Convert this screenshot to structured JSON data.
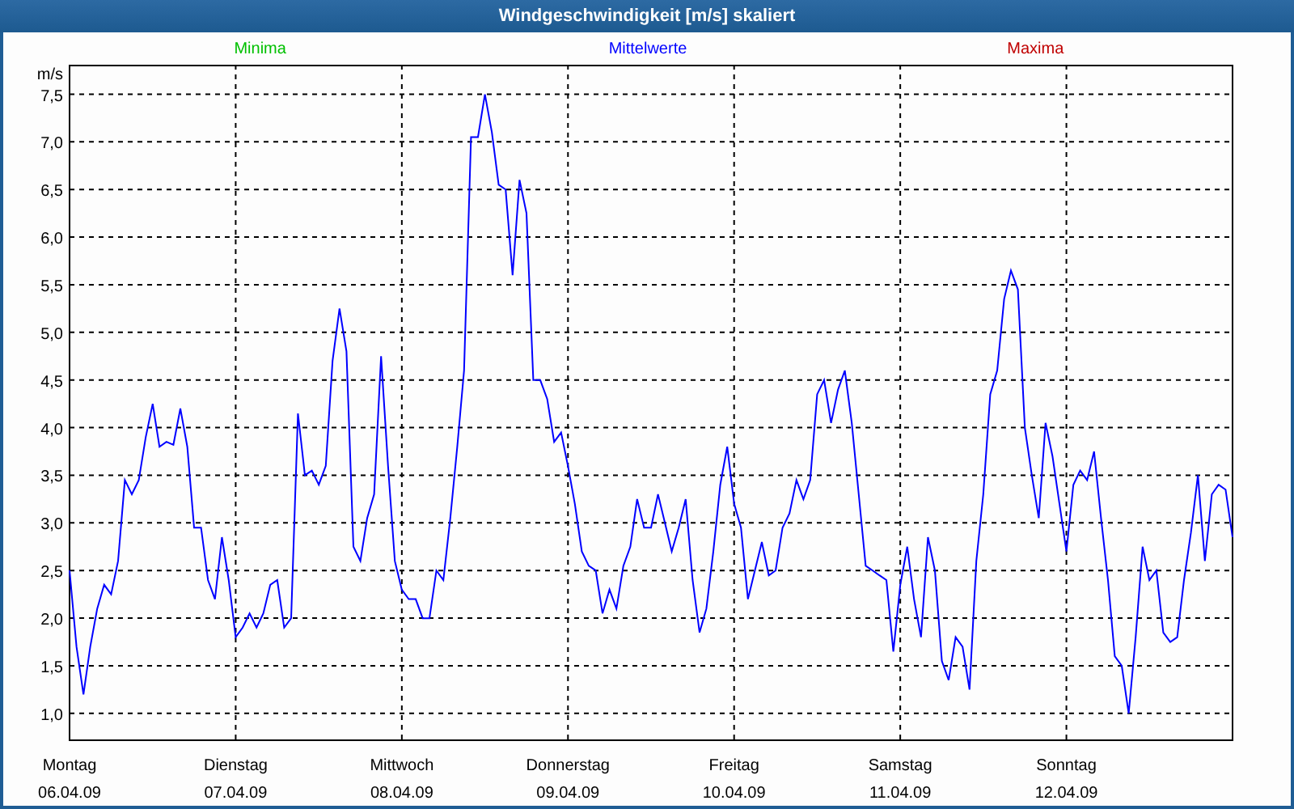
{
  "window": {
    "title": "Windgeschwindigkeit [m/s] skaliert"
  },
  "chart": {
    "legend": [
      {
        "kind": "label",
        "label": "Minima",
        "color": "#00c000"
      },
      {
        "kind": "series"
      },
      {
        "kind": "label",
        "label": "Maxima",
        "color": "#c00000"
      }
    ],
    "dates": [
      "06.04.09",
      "07.04.09",
      "08.04.09",
      "09.04.09",
      "10.04.09",
      "11.04.09",
      "12.04.09"
    ],
    "chart_data": {
      "type": "line",
      "grid": true,
      "ylabel": "m/s",
      "ylim": [
        0.71,
        7.81
      ],
      "categories": [
        "Montag",
        null,
        null,
        null,
        null,
        null,
        null,
        null,
        null,
        null,
        null,
        null,
        null,
        null,
        null,
        null,
        null,
        null,
        null,
        null,
        null,
        null,
        null,
        null,
        "Dienstag",
        null,
        null,
        null,
        null,
        null,
        null,
        null,
        null,
        null,
        null,
        null,
        null,
        null,
        null,
        null,
        null,
        null,
        null,
        null,
        null,
        null,
        null,
        null,
        "Mittwoch",
        null,
        null,
        null,
        null,
        null,
        null,
        null,
        null,
        null,
        null,
        null,
        null,
        null,
        null,
        null,
        null,
        null,
        null,
        null,
        null,
        null,
        null,
        null,
        "Donnerstag",
        null,
        null,
        null,
        null,
        null,
        null,
        null,
        null,
        null,
        null,
        null,
        null,
        null,
        null,
        null,
        null,
        null,
        null,
        null,
        null,
        null,
        null,
        null,
        "Freitag",
        null,
        null,
        null,
        null,
        null,
        null,
        null,
        null,
        null,
        null,
        null,
        null,
        null,
        null,
        null,
        null,
        null,
        null,
        null,
        null,
        null,
        null,
        null,
        "Samstag",
        null,
        null,
        null,
        null,
        null,
        null,
        null,
        null,
        null,
        null,
        null,
        null,
        null,
        null,
        null,
        null,
        null,
        null,
        null,
        null,
        null,
        null,
        null,
        "Sonntag",
        null,
        null,
        null,
        null,
        null,
        null,
        null,
        null,
        null,
        null,
        null,
        null,
        null,
        null,
        null,
        null,
        null,
        null,
        null,
        null,
        null,
        null,
        null,
        null
      ],
      "series": [
        {
          "name": "Mittelwerte",
          "color": "#0000ff",
          "values": [
            2.5,
            1.7,
            1.2,
            1.7,
            2.1,
            2.35,
            2.25,
            2.6,
            3.45,
            3.3,
            3.45,
            3.9,
            4.25,
            3.8,
            3.85,
            3.82,
            4.2,
            3.8,
            2.95,
            2.95,
            2.4,
            2.2,
            2.85,
            2.4,
            1.8,
            1.9,
            2.05,
            1.9,
            2.05,
            2.35,
            2.4,
            1.9,
            2.0,
            4.15,
            3.5,
            3.55,
            3.4,
            3.6,
            4.7,
            5.25,
            4.8,
            2.75,
            2.6,
            3.05,
            3.3,
            4.75,
            3.6,
            2.6,
            2.3,
            2.2,
            2.2,
            2.0,
            2.0,
            2.5,
            2.4,
            3.05,
            3.8,
            4.6,
            7.05,
            7.05,
            7.5,
            7.1,
            6.55,
            6.5,
            5.6,
            6.6,
            6.25,
            4.5,
            4.5,
            4.3,
            3.85,
            3.95,
            3.6,
            3.2,
            2.7,
            2.55,
            2.5,
            2.05,
            2.3,
            2.1,
            2.55,
            2.75,
            3.25,
            2.95,
            2.95,
            3.3,
            3.0,
            2.7,
            2.95,
            3.25,
            2.4,
            1.85,
            2.1,
            2.7,
            3.4,
            3.8,
            3.2,
            2.95,
            2.2,
            2.5,
            2.8,
            2.45,
            2.5,
            2.95,
            3.1,
            3.45,
            3.25,
            3.45,
            4.35,
            4.5,
            4.05,
            4.4,
            4.6,
            4.05,
            3.3,
            2.55,
            2.5,
            2.45,
            2.4,
            1.65,
            2.35,
            2.75,
            2.2,
            1.8,
            2.85,
            2.5,
            1.55,
            1.35,
            1.8,
            1.7,
            1.25,
            2.6,
            3.3,
            4.35,
            4.6,
            5.35,
            5.65,
            5.45,
            4.0,
            3.5,
            3.05,
            4.05,
            3.7,
            3.2,
            2.7,
            3.4,
            3.55,
            3.45,
            3.75,
            3.05,
            2.4,
            1.6,
            1.5,
            1.0,
            1.8,
            2.75,
            2.4,
            2.5,
            1.85,
            1.75,
            1.8,
            2.4,
            2.9,
            3.5,
            2.6,
            3.3,
            3.4,
            3.35,
            2.85
          ]
        }
      ],
      "yticks": [
        {
          "value": 1,
          "label": "1,0"
        },
        {
          "value": 1.5,
          "label": "1,5"
        },
        {
          "value": 2,
          "label": "2,0"
        },
        {
          "value": 2.5,
          "label": "2,5"
        },
        {
          "value": 3,
          "label": "3,0"
        },
        {
          "value": 3.5,
          "label": "3,5"
        },
        {
          "value": 4,
          "label": "4,0"
        },
        {
          "value": 4.5,
          "label": "4,5"
        },
        {
          "value": 5,
          "label": "5,0"
        },
        {
          "value": 5.5,
          "label": "5,5"
        },
        {
          "value": 6,
          "label": "6,0"
        },
        {
          "value": 6.5,
          "label": "6,5"
        },
        {
          "value": 7,
          "label": "7,0"
        },
        {
          "value": 7.5,
          "label": "7,5"
        }
      ]
    }
  }
}
